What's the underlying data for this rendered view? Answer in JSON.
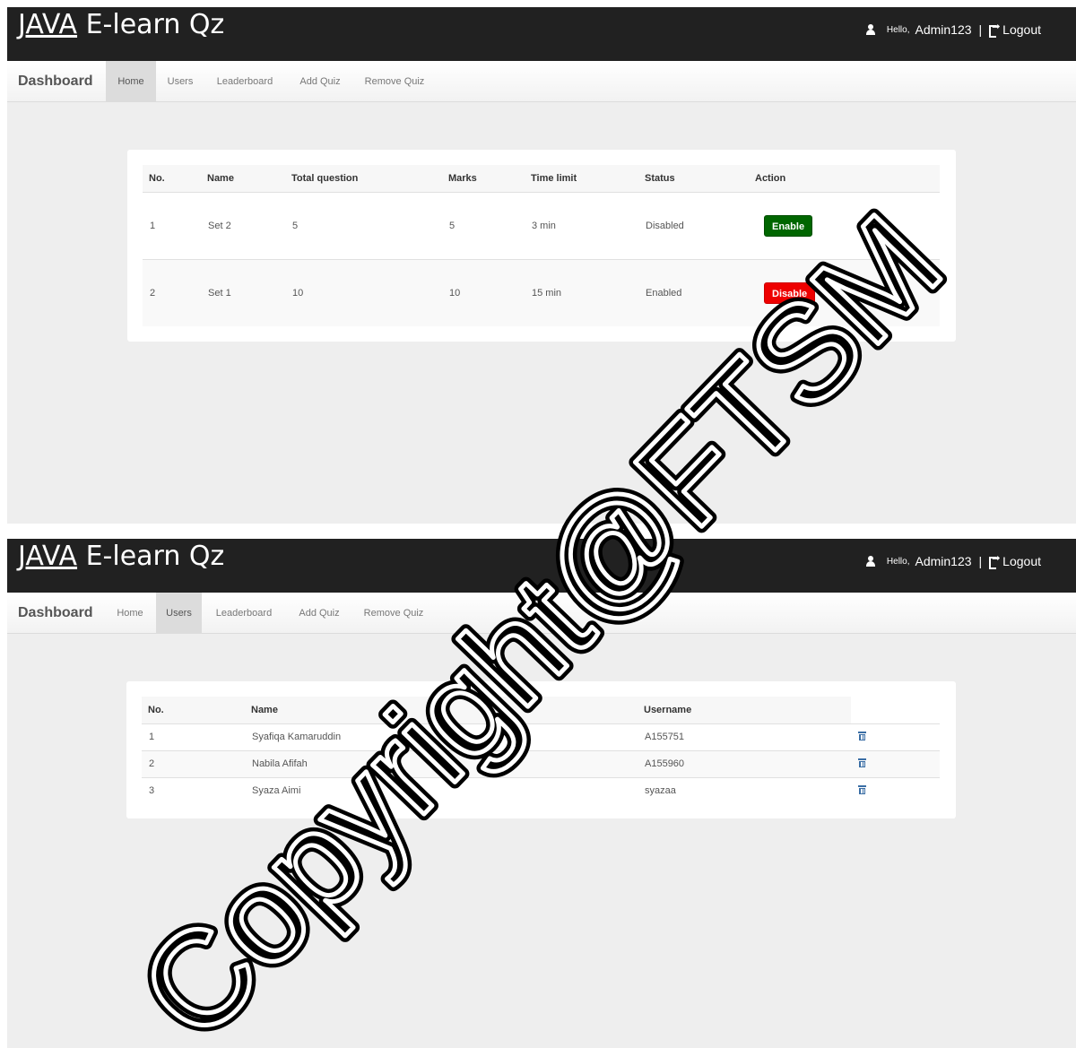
{
  "app": {
    "brand_java": "JAVA",
    "brand_rest": " E-learn Qz",
    "hello_label": "Hello,",
    "username": "Admin123",
    "separator": "|",
    "logout_label": "Logout"
  },
  "nav": {
    "brand": "Dashboard",
    "items": [
      "Home",
      "Users",
      "Leaderboard",
      "Add Quiz",
      "Remove Quiz"
    ]
  },
  "screen1": {
    "active_tab": "Home",
    "headers": [
      "No.",
      "Name",
      "Total question",
      "Marks",
      "Time limit",
      "Status",
      "Action"
    ],
    "rows": [
      {
        "no": "1",
        "name": "Set 2",
        "total": "5",
        "marks": "5",
        "time": "3 min",
        "status": "Disabled",
        "action": "Enable"
      },
      {
        "no": "2",
        "name": "Set 1",
        "total": "10",
        "marks": "10",
        "time": "15 min",
        "status": "Enabled",
        "action": "Disable"
      }
    ]
  },
  "screen2": {
    "active_tab": "Users",
    "headers": [
      "No.",
      "Name",
      "Username"
    ],
    "rows": [
      {
        "no": "1",
        "name": "Syafiqa Kamaruddin",
        "username": "A155751"
      },
      {
        "no": "2",
        "name": "Nabila Afifah",
        "username": "A155960"
      },
      {
        "no": "3",
        "name": "Syaza Aimi",
        "username": "syazaa"
      }
    ]
  },
  "watermark": {
    "text": "Copyright@FTSM",
    "color": "#000000"
  },
  "colors": {
    "topbar": "#212121",
    "enable_button": "#006600",
    "disable_button": "#ee0000",
    "trash_icon": "#3a6ea5"
  }
}
